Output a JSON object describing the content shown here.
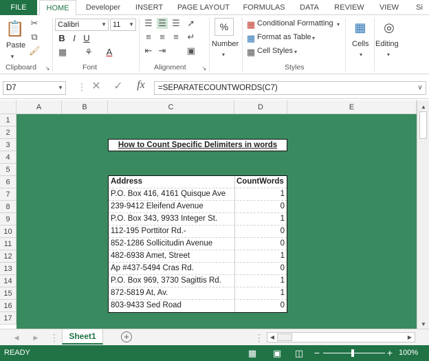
{
  "tabs": [
    "FILE",
    "HOME",
    "Developer",
    "INSERT",
    "PAGE LAYOUT",
    "FORMULAS",
    "DATA",
    "REVIEW",
    "VIEW",
    "Si"
  ],
  "ribbon": {
    "clipboard_label": "Clipboard",
    "paste_label": "Paste",
    "font_label": "Font",
    "font_name": "Calibri",
    "font_size": "11",
    "alignment_label": "Alignment",
    "number_label": "Number",
    "number_symbol": "%",
    "styles_label": "Styles",
    "conditional_formatting": "Conditional Formatting",
    "format_as_table": "Format as Table",
    "cell_styles": "Cell Styles",
    "cells_label": "Cells",
    "editing_label": "Editing"
  },
  "formula_bar": {
    "name_box": "D7",
    "fx": "fx",
    "formula": "=SEPARATECOUNTWORDS(C7)"
  },
  "columns": [
    "A",
    "B",
    "C",
    "D",
    "E"
  ],
  "rows": [
    "1",
    "2",
    "3",
    "4",
    "5",
    "6",
    "7",
    "8",
    "9",
    "10",
    "11",
    "12",
    "13",
    "14",
    "15",
    "16",
    "17"
  ],
  "sheet": {
    "title": "How to Count Specific Delimiters in words",
    "header_address": "Address",
    "header_count": "CountWords",
    "rows": [
      {
        "address": "P.O. Box 416, 4161 Quisque Ave",
        "count": "1"
      },
      {
        "address": "239-9412 Eleifend Avenue",
        "count": "0"
      },
      {
        "address": "P.O. Box 343, 9933 Integer St.",
        "count": "1"
      },
      {
        "address": "112-195 Porttitor Rd.-",
        "count": "0"
      },
      {
        "address": "852-1286 Sollicitudin Avenue",
        "count": "0"
      },
      {
        "address": "482-6938 Amet, Street",
        "count": "1"
      },
      {
        "address": "Ap #437-5494 Cras Rd.",
        "count": "0"
      },
      {
        "address": "P.O. Box 969, 3730 Sagittis Rd.",
        "count": "1"
      },
      {
        "address": "872-5819 At, Av.",
        "count": "1"
      },
      {
        "address": "803-9433 Sed Road",
        "count": "0"
      }
    ]
  },
  "sheet_tab": "Sheet1",
  "status": {
    "ready": "READY",
    "zoom": "100%"
  },
  "colors": {
    "accent": "#217346",
    "sheet_fill": "#3a8a5f"
  }
}
